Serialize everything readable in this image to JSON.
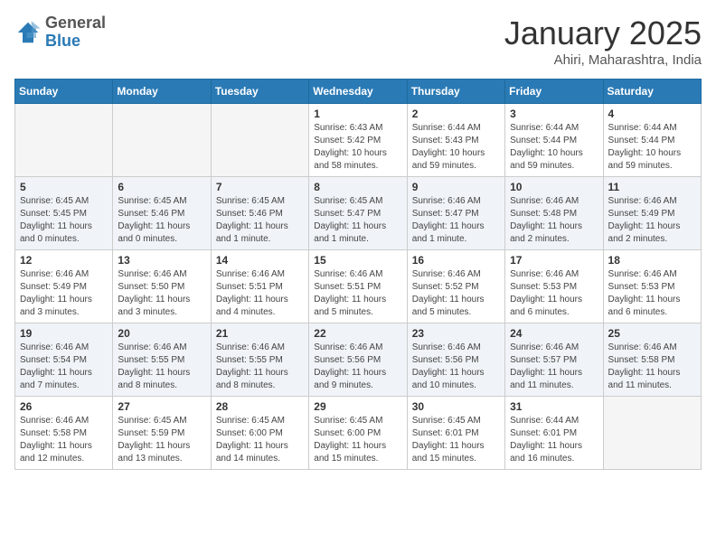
{
  "header": {
    "logo_general": "General",
    "logo_blue": "Blue",
    "month_title": "January 2025",
    "location": "Ahiri, Maharashtra, India"
  },
  "days_of_week": [
    "Sunday",
    "Monday",
    "Tuesday",
    "Wednesday",
    "Thursday",
    "Friday",
    "Saturday"
  ],
  "weeks": [
    [
      {
        "num": "",
        "info": ""
      },
      {
        "num": "",
        "info": ""
      },
      {
        "num": "",
        "info": ""
      },
      {
        "num": "1",
        "info": "Sunrise: 6:43 AM\nSunset: 5:42 PM\nDaylight: 10 hours\nand 58 minutes."
      },
      {
        "num": "2",
        "info": "Sunrise: 6:44 AM\nSunset: 5:43 PM\nDaylight: 10 hours\nand 59 minutes."
      },
      {
        "num": "3",
        "info": "Sunrise: 6:44 AM\nSunset: 5:44 PM\nDaylight: 10 hours\nand 59 minutes."
      },
      {
        "num": "4",
        "info": "Sunrise: 6:44 AM\nSunset: 5:44 PM\nDaylight: 10 hours\nand 59 minutes."
      }
    ],
    [
      {
        "num": "5",
        "info": "Sunrise: 6:45 AM\nSunset: 5:45 PM\nDaylight: 11 hours\nand 0 minutes."
      },
      {
        "num": "6",
        "info": "Sunrise: 6:45 AM\nSunset: 5:46 PM\nDaylight: 11 hours\nand 0 minutes."
      },
      {
        "num": "7",
        "info": "Sunrise: 6:45 AM\nSunset: 5:46 PM\nDaylight: 11 hours\nand 1 minute."
      },
      {
        "num": "8",
        "info": "Sunrise: 6:45 AM\nSunset: 5:47 PM\nDaylight: 11 hours\nand 1 minute."
      },
      {
        "num": "9",
        "info": "Sunrise: 6:46 AM\nSunset: 5:47 PM\nDaylight: 11 hours\nand 1 minute."
      },
      {
        "num": "10",
        "info": "Sunrise: 6:46 AM\nSunset: 5:48 PM\nDaylight: 11 hours\nand 2 minutes."
      },
      {
        "num": "11",
        "info": "Sunrise: 6:46 AM\nSunset: 5:49 PM\nDaylight: 11 hours\nand 2 minutes."
      }
    ],
    [
      {
        "num": "12",
        "info": "Sunrise: 6:46 AM\nSunset: 5:49 PM\nDaylight: 11 hours\nand 3 minutes."
      },
      {
        "num": "13",
        "info": "Sunrise: 6:46 AM\nSunset: 5:50 PM\nDaylight: 11 hours\nand 3 minutes."
      },
      {
        "num": "14",
        "info": "Sunrise: 6:46 AM\nSunset: 5:51 PM\nDaylight: 11 hours\nand 4 minutes."
      },
      {
        "num": "15",
        "info": "Sunrise: 6:46 AM\nSunset: 5:51 PM\nDaylight: 11 hours\nand 5 minutes."
      },
      {
        "num": "16",
        "info": "Sunrise: 6:46 AM\nSunset: 5:52 PM\nDaylight: 11 hours\nand 5 minutes."
      },
      {
        "num": "17",
        "info": "Sunrise: 6:46 AM\nSunset: 5:53 PM\nDaylight: 11 hours\nand 6 minutes."
      },
      {
        "num": "18",
        "info": "Sunrise: 6:46 AM\nSunset: 5:53 PM\nDaylight: 11 hours\nand 6 minutes."
      }
    ],
    [
      {
        "num": "19",
        "info": "Sunrise: 6:46 AM\nSunset: 5:54 PM\nDaylight: 11 hours\nand 7 minutes."
      },
      {
        "num": "20",
        "info": "Sunrise: 6:46 AM\nSunset: 5:55 PM\nDaylight: 11 hours\nand 8 minutes."
      },
      {
        "num": "21",
        "info": "Sunrise: 6:46 AM\nSunset: 5:55 PM\nDaylight: 11 hours\nand 8 minutes."
      },
      {
        "num": "22",
        "info": "Sunrise: 6:46 AM\nSunset: 5:56 PM\nDaylight: 11 hours\nand 9 minutes."
      },
      {
        "num": "23",
        "info": "Sunrise: 6:46 AM\nSunset: 5:56 PM\nDaylight: 11 hours\nand 10 minutes."
      },
      {
        "num": "24",
        "info": "Sunrise: 6:46 AM\nSunset: 5:57 PM\nDaylight: 11 hours\nand 11 minutes."
      },
      {
        "num": "25",
        "info": "Sunrise: 6:46 AM\nSunset: 5:58 PM\nDaylight: 11 hours\nand 11 minutes."
      }
    ],
    [
      {
        "num": "26",
        "info": "Sunrise: 6:46 AM\nSunset: 5:58 PM\nDaylight: 11 hours\nand 12 minutes."
      },
      {
        "num": "27",
        "info": "Sunrise: 6:45 AM\nSunset: 5:59 PM\nDaylight: 11 hours\nand 13 minutes."
      },
      {
        "num": "28",
        "info": "Sunrise: 6:45 AM\nSunset: 6:00 PM\nDaylight: 11 hours\nand 14 minutes."
      },
      {
        "num": "29",
        "info": "Sunrise: 6:45 AM\nSunset: 6:00 PM\nDaylight: 11 hours\nand 15 minutes."
      },
      {
        "num": "30",
        "info": "Sunrise: 6:45 AM\nSunset: 6:01 PM\nDaylight: 11 hours\nand 15 minutes."
      },
      {
        "num": "31",
        "info": "Sunrise: 6:44 AM\nSunset: 6:01 PM\nDaylight: 11 hours\nand 16 minutes."
      },
      {
        "num": "",
        "info": ""
      }
    ]
  ]
}
